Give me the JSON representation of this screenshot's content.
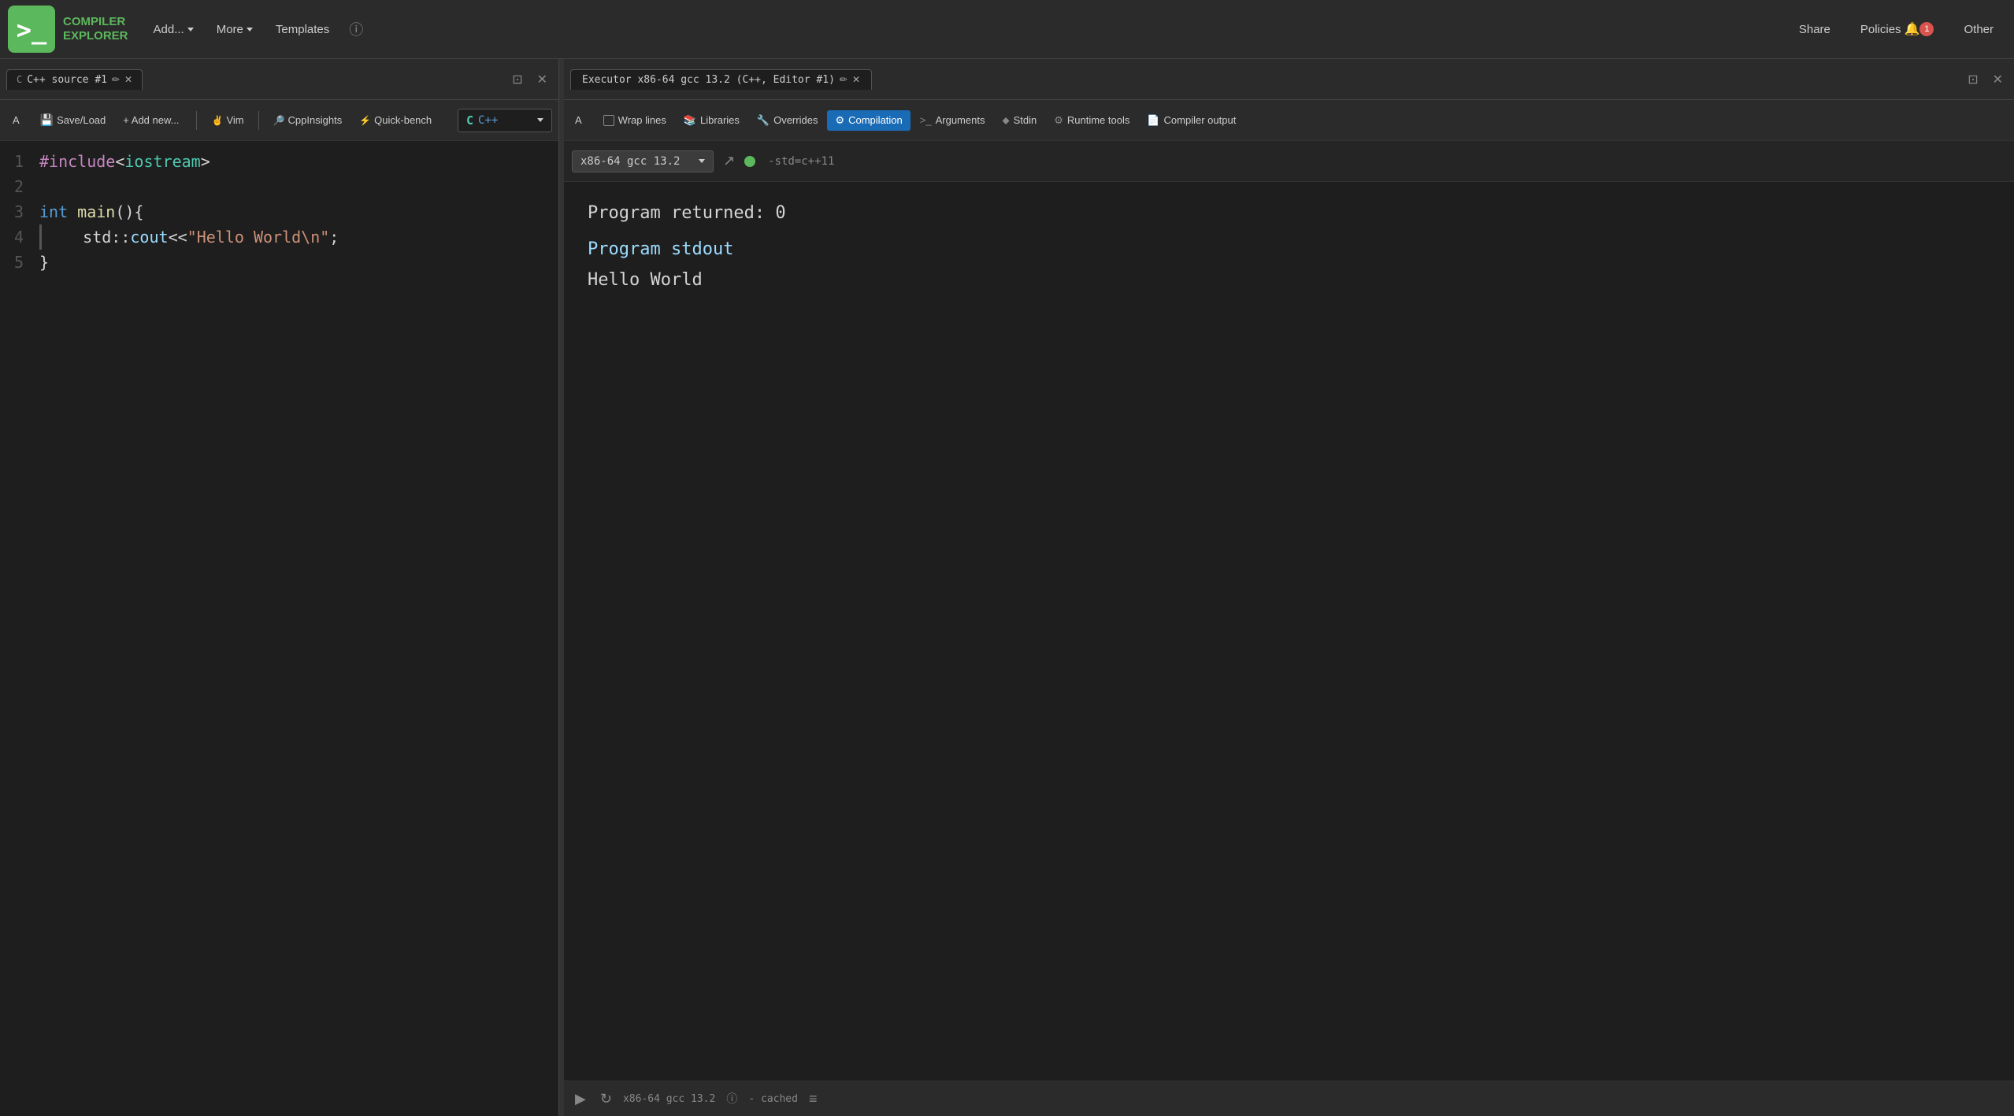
{
  "app": {
    "name_line1": "COMPILER",
    "name_line2": "EXPLORER"
  },
  "navbar": {
    "add_label": "Add...",
    "more_label": "More",
    "templates_label": "Templates",
    "share_label": "Share",
    "policies_label": "Policies",
    "other_label": "Other"
  },
  "editor": {
    "tab_title": "C++ source #1",
    "save_load_label": "Save/Load",
    "add_new_label": "+ Add new...",
    "vim_label": "Vim",
    "cppinsights_label": "CppInsights",
    "quickbench_label": "Quick-bench",
    "language_label": "C++",
    "font_size_label": "A",
    "lines": [
      {
        "num": "1",
        "content": "#include<iostream>"
      },
      {
        "num": "2",
        "content": ""
      },
      {
        "num": "3",
        "content": "int main(){"
      },
      {
        "num": "4",
        "content": "    std::cout<<\"Hello World\\n\";"
      },
      {
        "num": "5",
        "content": "}"
      }
    ]
  },
  "executor": {
    "tab_title": "Executor x86-64 gcc 13.2 (C++, Editor #1)",
    "tabs": {
      "font_size": "A",
      "wrap_lines": "Wrap lines",
      "libraries": "Libraries",
      "overrides": "Overrides",
      "compilation": "Compilation",
      "arguments": "Arguments",
      "stdin": "Stdin",
      "runtime_tools": "Runtime tools",
      "compiler_output": "Compiler output"
    },
    "compiler": {
      "name": "x86-64 gcc 13.2",
      "flags": "-std=c++11",
      "status": "ok"
    },
    "output": {
      "program_returned": "Program returned: 0",
      "program_stdout": "Program stdout",
      "hello_world": "Hello World"
    },
    "statusbar": {
      "compiler": "x86-64 gcc 13.2",
      "cached_label": "- cached"
    }
  }
}
